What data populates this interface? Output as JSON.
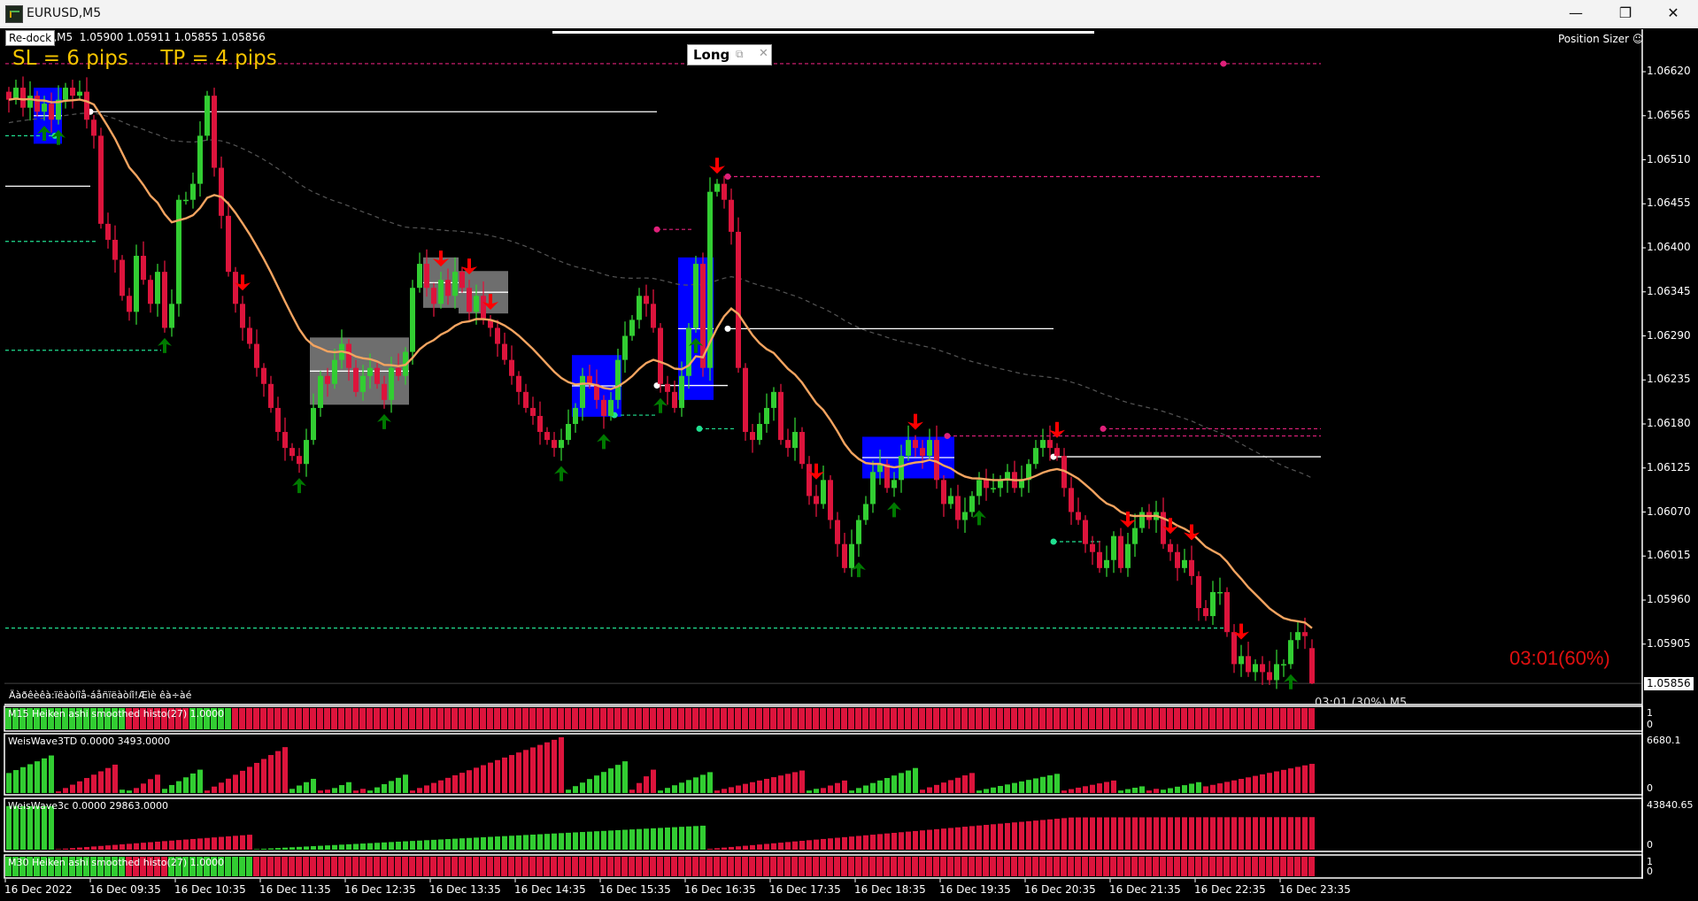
{
  "window": {
    "title": "EURUSD,M5",
    "buttons": {
      "minimize": "—",
      "restore": "❐",
      "close": "✕"
    }
  },
  "chart": {
    "redock_label": "Re-dock",
    "ohlc_text": "EURUSD,M5  1.05900 1.05911 1.05855 1.05856",
    "sltp_text": "SL = 6 pips     TP = 4 pips",
    "long_panel": {
      "label": "Long",
      "pin_icon": "⧉",
      "close_icon": "✕"
    },
    "position_sizer": "Position Sizer ☺",
    "timer_big": "03:01(60%)",
    "timer_small": "03:01 (30%) M5",
    "indicator_text": "Äàðêèêà:ïëàòíîå-áåñïëàòíî!Æìè êà÷àé",
    "current_price": "1.05856",
    "price_axis": [
      "1.06620",
      "1.06565",
      "1.06510",
      "1.06455",
      "1.06400",
      "1.06345",
      "1.06290",
      "1.06235",
      "1.06180",
      "1.06125",
      "1.06070",
      "1.06015",
      "1.05960",
      "1.05905"
    ],
    "time_axis": [
      "16 Dec 2022",
      "16 Dec 09:35",
      "16 Dec 10:35",
      "16 Dec 11:35",
      "16 Dec 12:35",
      "16 Dec 13:35",
      "16 Dec 14:35",
      "16 Dec 15:35",
      "16 Dec 16:35",
      "16 Dec 17:35",
      "16 Dec 18:35",
      "16 Dec 19:35",
      "16 Dec 20:35",
      "16 Dec 21:35",
      "16 Dec 22:35",
      "16 Dec 23:35"
    ],
    "colors": {
      "bull": "#32cd32",
      "bear": "#dc143c",
      "ema": "#f4a460",
      "slow_ma": "#555555",
      "up_arrow": "#007a00",
      "down_arrow": "#ff0000",
      "resistance": "#e0207a",
      "support": "#20e090",
      "level": "#ffffff",
      "blue_zone": "#0000ff",
      "gray_zone": "#6e6e6e"
    }
  },
  "chart_data": {
    "type": "candlestick",
    "symbol": "EURUSD",
    "timeframe": "M5",
    "ylim": [
      1.0583,
      1.0666
    ],
    "close": [
      1.06585,
      1.066,
      1.06575,
      1.0659,
      1.0657,
      1.0658,
      1.0656,
      1.06585,
      1.066,
      1.0659,
      1.06595,
      1.0656,
      1.0654,
      1.0643,
      1.0641,
      1.06385,
      1.0634,
      1.0632,
      1.0639,
      1.0636,
      1.0633,
      1.0637,
      1.063,
      1.0633,
      1.0646,
      1.0646,
      1.0648,
      1.0654,
      1.0659,
      1.065,
      1.0644,
      1.0637,
      1.0633,
      1.063,
      1.0628,
      1.0625,
      1.0623,
      1.062,
      1.0617,
      1.0615,
      1.0614,
      1.0613,
      1.0616,
      1.062,
      1.0624,
      1.0623,
      1.0626,
      1.0628,
      1.0625,
      1.0622,
      1.0624,
      1.0625,
      1.0623,
      1.0621,
      1.0625,
      1.0624,
      1.0627,
      1.0635,
      1.0638,
      1.0635,
      1.0633,
      1.0636,
      1.0634,
      1.0637,
      1.0635,
      1.0632,
      1.0634,
      1.0631,
      1.063,
      1.0628,
      1.0626,
      1.0624,
      1.0622,
      1.062,
      1.0619,
      1.0617,
      1.0616,
      1.0615,
      1.0616,
      1.0618,
      1.062,
      1.0624,
      1.0623,
      1.0621,
      1.0619,
      1.0621,
      1.0626,
      1.0629,
      1.0631,
      1.0634,
      1.0633,
      1.063,
      1.0623,
      1.0622,
      1.062,
      1.0624,
      1.063,
      1.0638,
      1.0625,
      1.0647,
      1.0648,
      1.0646,
      1.0642,
      1.0625,
      1.0617,
      1.0616,
      1.0618,
      1.062,
      1.0622,
      1.0616,
      1.0615,
      1.0617,
      1.0613,
      1.0609,
      1.0608,
      1.0611,
      1.0606,
      1.0603,
      1.06,
      1.0603,
      1.0606,
      1.0608,
      1.0612,
      1.0613,
      1.061,
      1.0611,
      1.0614,
      1.0616,
      1.0615,
      1.0614,
      1.0616,
      1.0611,
      1.0608,
      1.0609,
      1.0606,
      1.0607,
      1.0609,
      1.0611,
      1.061,
      1.061,
      1.0611,
      1.0612,
      1.061,
      1.0611,
      1.0613,
      1.0615,
      1.0616,
      1.0615,
      1.0614,
      1.061,
      1.0607,
      1.0606,
      1.0603,
      1.0602,
      1.06,
      1.0601,
      1.0604,
      1.06,
      1.0603,
      1.0605,
      1.0607,
      1.0606,
      1.0607,
      1.0603,
      1.0602,
      1.06,
      1.0601,
      1.0599,
      1.0595,
      1.0594,
      1.0597,
      1.0597,
      1.0592,
      1.0588,
      1.0589,
      1.0587,
      1.0588,
      1.0587,
      1.0586,
      1.0588,
      1.0588,
      1.0591,
      1.0592,
      1.05915,
      1.05856
    ],
    "last_bar": {
      "open": 1.059,
      "high": 1.05911,
      "low": 1.05855,
      "close": 1.05856
    },
    "up_arrows": [
      5,
      7,
      22,
      41,
      53,
      78,
      84,
      92,
      97,
      120,
      125,
      137,
      181
    ],
    "down_arrows": [
      33,
      61,
      65,
      68,
      100,
      114,
      128,
      148,
      158,
      164,
      167,
      174
    ],
    "zones": [
      {
        "kind": "blue",
        "from_bar": 4,
        "to_bar": 7,
        "top": 1.066,
        "bottom": 1.0653
      },
      {
        "kind": "gray",
        "from_bar": 43,
        "to_bar": 56,
        "top": 1.06288,
        "bottom": 1.06204
      },
      {
        "kind": "gray",
        "from_bar": 59,
        "to_bar": 63,
        "top": 1.06388,
        "bottom": 1.06325
      },
      {
        "kind": "gray",
        "from_bar": 64,
        "to_bar": 70,
        "top": 1.06371,
        "bottom": 1.06318
      },
      {
        "kind": "blue",
        "from_bar": 80,
        "to_bar": 86,
        "top": 1.06266,
        "bottom": 1.06189
      },
      {
        "kind": "blue",
        "from_bar": 95,
        "to_bar": 99,
        "top": 1.06388,
        "bottom": 1.0621
      },
      {
        "kind": "blue",
        "from_bar": 121,
        "to_bar": 133,
        "top": 1.06164,
        "bottom": 1.06112
      }
    ],
    "levels": [
      {
        "kind": "level",
        "price": 1.0657,
        "from_bar": 12,
        "to_bar": 92,
        "dot": true
      },
      {
        "kind": "level",
        "price": 1.06477,
        "from_bar": 0,
        "to_bar": 12,
        "dot": false
      },
      {
        "kind": "level",
        "price": 1.06299,
        "from_bar": 102,
        "to_bar": 148,
        "dot": true
      },
      {
        "kind": "level",
        "price": 1.06228,
        "from_bar": 92,
        "to_bar": 102,
        "dot": true
      },
      {
        "kind": "level",
        "price": 1.06139,
        "from_bar": 148,
        "to_bar": 186,
        "dot": true
      },
      {
        "kind": "resistance",
        "price": 1.0663,
        "from_bar": 0,
        "to_bar": 186,
        "dot_bar": 172
      },
      {
        "kind": "resistance",
        "price": 1.06489,
        "from_bar": 102,
        "to_bar": 186,
        "dot_bar": 102
      },
      {
        "kind": "resistance",
        "price": 1.06423,
        "from_bar": 92,
        "to_bar": 97,
        "dot_bar": 92
      },
      {
        "kind": "resistance",
        "price": 1.06165,
        "from_bar": 133,
        "to_bar": 186,
        "dot_bar": 133
      },
      {
        "kind": "resistance",
        "price": 1.06174,
        "from_bar": 155,
        "to_bar": 186,
        "dot_bar": 155
      },
      {
        "kind": "support",
        "price": 1.0654,
        "from_bar": 0,
        "to_bar": 7,
        "dot_bar": 7
      },
      {
        "kind": "support",
        "price": 1.06408,
        "from_bar": 0,
        "to_bar": 13,
        "dot_bar": null
      },
      {
        "kind": "support",
        "price": 1.06272,
        "from_bar": 0,
        "to_bar": 22,
        "dot_bar": null
      },
      {
        "kind": "support",
        "price": 1.06191,
        "from_bar": 86,
        "to_bar": 92,
        "dot_bar": 86
      },
      {
        "kind": "support",
        "price": 1.06174,
        "from_bar": 98,
        "to_bar": 103,
        "dot_bar": 98
      },
      {
        "kind": "support",
        "price": 1.06033,
        "from_bar": 148,
        "to_bar": 155,
        "dot_bar": 148
      },
      {
        "kind": "support",
        "price": 1.05925,
        "from_bar": 0,
        "to_bar": 172,
        "dot_bar": null
      }
    ],
    "panes": [
      {
        "label": "M15 Heiken ashi smoothed histo(27) 1.0000",
        "scale": [
          "1",
          "0"
        ],
        "type": "histo",
        "segments": [
          {
            "dir": "up",
            "bars": 17
          },
          {
            "dir": "down",
            "bars": 9
          },
          {
            "dir": "up",
            "bars": 6
          },
          {
            "dir": "down",
            "bars": 153
          }
        ]
      },
      {
        "label": "WeisWave3TD 0.0000 3493.0000",
        "scale": [
          "6680.1",
          "0"
        ],
        "type": "waves",
        "max": 6680.1,
        "waves": [
          {
            "dir": "up",
            "bars": 7,
            "from": 2400,
            "to": 4500
          },
          {
            "dir": "down",
            "bars": 9,
            "from": 200,
            "to": 3400
          },
          {
            "dir": "up",
            "bars": 2,
            "from": 400,
            "to": 300
          },
          {
            "dir": "down",
            "bars": 4,
            "from": 600,
            "to": 2200
          },
          {
            "dir": "up",
            "bars": 6,
            "from": 500,
            "to": 2800
          },
          {
            "dir": "down",
            "bars": 12,
            "from": 300,
            "to": 5500
          },
          {
            "dir": "up",
            "bars": 4,
            "from": 500,
            "to": 1700
          },
          {
            "dir": "down",
            "bars": 2,
            "from": 300,
            "to": 400
          },
          {
            "dir": "up",
            "bars": 3,
            "from": 600,
            "to": 1300
          },
          {
            "dir": "down",
            "bars": 2,
            "from": 300,
            "to": 500
          },
          {
            "dir": "up",
            "bars": 6,
            "from": 300,
            "to": 2200
          },
          {
            "dir": "down",
            "bars": 22,
            "from": 300,
            "to": 6680
          },
          {
            "dir": "up",
            "bars": 9,
            "from": 400,
            "to": 3800
          },
          {
            "dir": "down",
            "bars": 4,
            "from": 400,
            "to": 2800
          },
          {
            "dir": "up",
            "bars": 8,
            "from": 300,
            "to": 2500
          },
          {
            "dir": "down",
            "bars": 13,
            "from": 300,
            "to": 2700
          },
          {
            "dir": "up",
            "bars": 2,
            "from": 300,
            "to": 500
          },
          {
            "dir": "down",
            "bars": 4,
            "from": 600,
            "to": 1500
          },
          {
            "dir": "up",
            "bars": 10,
            "from": 300,
            "to": 3000
          },
          {
            "dir": "down",
            "bars": 8,
            "from": 400,
            "to": 2400
          },
          {
            "dir": "up",
            "bars": 12,
            "from": 300,
            "to": 2300
          },
          {
            "dir": "down",
            "bars": 8,
            "from": 300,
            "to": 1500
          },
          {
            "dir": "up",
            "bars": 4,
            "from": 300,
            "to": 800
          },
          {
            "dir": "down",
            "bars": 2,
            "from": 300,
            "to": 500
          },
          {
            "dir": "up",
            "bars": 6,
            "from": 400,
            "to": 1300
          },
          {
            "dir": "down",
            "bars": 16,
            "from": 800,
            "to": 3493
          }
        ]
      },
      {
        "label": "WeisWave3c 0.0000 29863.0000",
        "scale": [
          "43840.65",
          "0"
        ],
        "type": "waves",
        "max": 43840.65,
        "waves": [
          {
            "dir": "up",
            "bars": 7,
            "from": 40000,
            "to": 40000
          },
          {
            "dir": "down",
            "bars": 28,
            "from": 500,
            "to": 13700
          },
          {
            "dir": "up",
            "bars": 64,
            "from": 500,
            "to": 22000
          },
          {
            "dir": "down",
            "bars": 52,
            "from": 800,
            "to": 29500
          },
          {
            "dir": "down",
            "bars": 34,
            "from": 29600,
            "to": 29863
          }
        ]
      },
      {
        "label": "M30 Heiken ashi smoothed histo(27) 1.0000",
        "scale": [
          "1",
          "0"
        ],
        "type": "histo",
        "segments": [
          {
            "dir": "up",
            "bars": 17
          },
          {
            "dir": "down",
            "bars": 6
          },
          {
            "dir": "up",
            "bars": 12
          },
          {
            "dir": "down",
            "bars": 150
          }
        ]
      }
    ]
  }
}
